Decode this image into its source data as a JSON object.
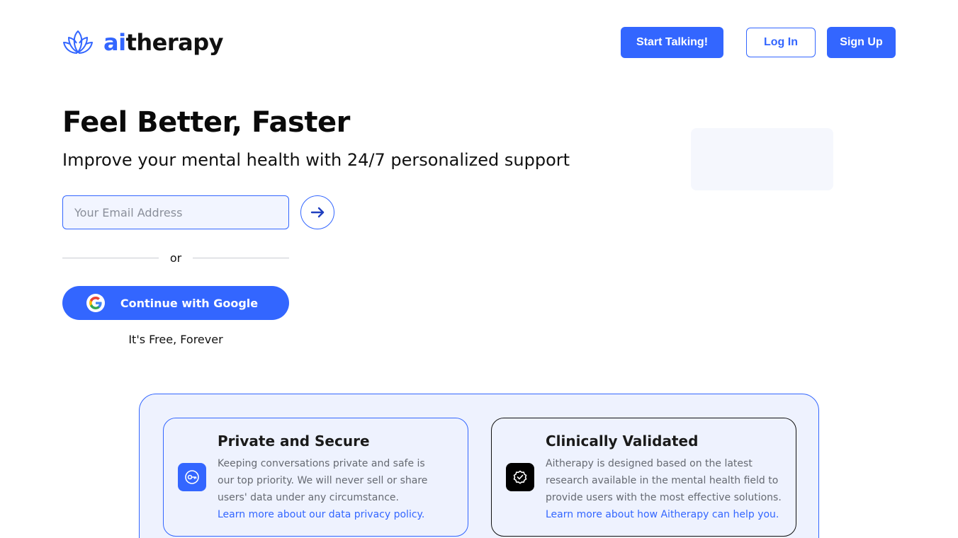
{
  "header": {
    "logo_accent": "ai",
    "logo_rest": "therapy",
    "logo_icon": "lotus-icon",
    "start_label": "Start Talking!",
    "login_label": "Log In",
    "signup_label": "Sign Up"
  },
  "hero": {
    "title": "Feel Better, Faster",
    "subtitle": "Improve your mental health with 24/7 personalized support",
    "email_placeholder": "Your Email Address",
    "submit_icon": "arrow-right-icon",
    "or_text": "or",
    "google_label": "Continue with Google",
    "free_text": "It's Free, Forever"
  },
  "features": [
    {
      "icon": "key-icon",
      "title": "Private and Secure",
      "body": "Keeping conversations private and safe is our top priority. We will never sell or share users' data under any circumstance.",
      "link": "Learn more about our data privacy policy."
    },
    {
      "icon": "verified-badge-icon",
      "title": "Clinically Validated",
      "body": "Aitherapy is designed based on the latest research available in the mental health field to provide users with the most effective solutions.",
      "link": "Learn more about how Aitherapy can help you."
    }
  ],
  "colors": {
    "brand": "#3366ff",
    "panel_bg": "#eef2fe",
    "text_dark": "#0a0a0a",
    "text_muted": "#666a72"
  }
}
